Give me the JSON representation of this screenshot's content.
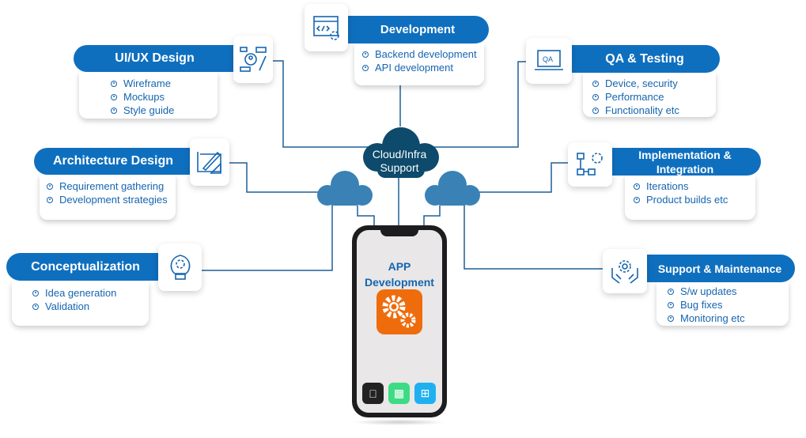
{
  "center": {
    "cloud_label": "Cloud/Infra Support",
    "app_title": "APP Development",
    "platforms": [
      "apple-icon",
      "android-icon",
      "windows-icon"
    ]
  },
  "colors": {
    "banner": "#0f6fbf",
    "lines": "#1f5f96",
    "cloud_dark": "#0d4a6b",
    "cloud_light": "#3a82b5",
    "app_icon": "#ef6c0c"
  },
  "cards": {
    "uiux": {
      "title": "UI/UX Design",
      "icon": "ui-design-icon",
      "items": [
        "Wireframe",
        "Mockups",
        "Style guide"
      ]
    },
    "architecture": {
      "title": "Architecture Design",
      "icon": "blueprint-icon",
      "items": [
        "Requirement gathering",
        "Development strategies"
      ]
    },
    "conceptualization": {
      "title": "Conceptualization",
      "icon": "lightbulb-gear-icon",
      "items": [
        "Idea generation",
        "Validation"
      ]
    },
    "development": {
      "title": "Development",
      "icon": "code-window-icon",
      "items": [
        "Backend development",
        "API development"
      ]
    },
    "qa": {
      "title": "QA & Testing",
      "icon": "qa-laptop-icon",
      "items": [
        "Device, security",
        "Performance",
        "Functionality etc"
      ]
    },
    "implementation": {
      "title": "Implementation & Integration",
      "icon": "flowchart-gear-icon",
      "items": [
        "Iterations",
        "Product builds etc"
      ]
    },
    "support": {
      "title": "Support & Maintenance",
      "icon": "hands-gear-icon",
      "items": [
        "S/w updates",
        "Bug fixes",
        "Monitoring etc"
      ]
    }
  }
}
